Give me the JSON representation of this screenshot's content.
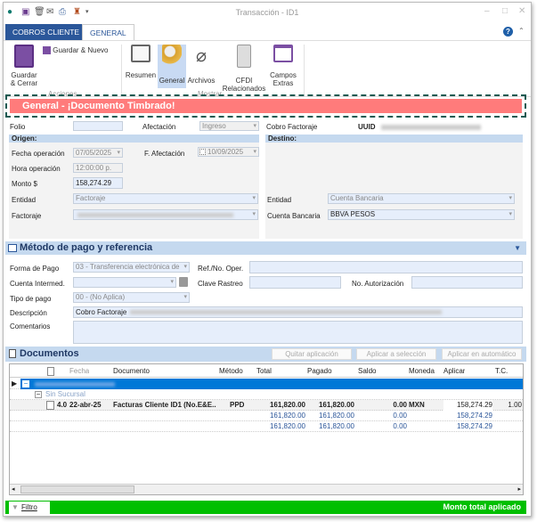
{
  "window": {
    "title": "Transacción - ID1"
  },
  "quick_access": [
    "app-icon",
    "save-icon",
    "delete-icon",
    "email-icon",
    "print-icon",
    "user-icon",
    "dropdown-icon"
  ],
  "tabs": [
    {
      "label": "COBROS CLIENTE"
    },
    {
      "label": "GENERAL"
    }
  ],
  "ribbon": {
    "actions": {
      "group": "Acciones",
      "save_close": "Guardar & Cerrar",
      "save_new": "Guardar & Nuevo"
    },
    "show": {
      "group": "Mostrar",
      "resumen": "Resumen",
      "general": "General",
      "archivos": "Archivos",
      "cfdi": "CFDI Relacionados",
      "campos": "Campos Extras"
    }
  },
  "banner": {
    "text": "General - ¡Documento Timbrado!"
  },
  "form": {
    "folio_label": "Folio",
    "folio": "",
    "afectacion_label": "Afectación",
    "afectacion": "Ingreso",
    "cobro_factoraje_label": "Cobro Factoraje",
    "uuid_label": "UUID",
    "origen": "Origen:",
    "destino": "Destino:",
    "fecha_op_label": "Fecha operación",
    "fecha_op": "07/05/2025",
    "f_afect_label": "F. Afectación",
    "f_afect": "10/09/2025",
    "hora_label": "Hora operación",
    "hora": "12:00:00 p.",
    "monto_label": "Monto  $",
    "monto": "158,274.29",
    "entidad_label": "Entidad",
    "entidad": "Factoraje",
    "factoraje_label": "Factoraje",
    "dest_entidad_label": "Entidad",
    "dest_entidad": "Cuenta Bancaria",
    "cuenta_label": "Cuenta Bancaria",
    "cuenta": "BBVA PESOS"
  },
  "metodo": {
    "title": "Método de pago y referencia",
    "forma_label": "Forma de Pago",
    "forma": "03 - Transferencia electrónica de",
    "ref_label": "Ref./No. Oper.",
    "cuenta_label": "Cuenta Intermed.",
    "clave_label": "Clave Rastreo",
    "aut_label": "No. Autorización",
    "tipo_label": "Tipo de pago",
    "tipo": "00 - (No Aplica)",
    "desc_label": "Descripción",
    "desc": "Cobro Factoraje",
    "coment_label": "Comentarios"
  },
  "documentos": {
    "title": "Documentos",
    "btn_quitar": "Quitar aplicación",
    "btn_sel": "Aplicar a selección",
    "btn_auto": "Aplicar en automático",
    "columns": [
      "Fecha",
      "Documento",
      "Método",
      "Total",
      "Pagado",
      "Saldo",
      "Moneda",
      "Aplicar",
      "T.C."
    ],
    "group2": "Sin Sucursal",
    "row": {
      "ver": "4.0",
      "fecha": "22-abr-25",
      "documento": "Facturas Cliente ID1 (No.E&E...",
      "metodo": "PPD",
      "total": "161,820.00",
      "pagado": "161,820.00",
      "saldo": "0.00",
      "moneda": "MXN",
      "aplicar": "158,274.29",
      "tc": "1.00"
    },
    "subtotal": {
      "total": "161,820.00",
      "pagado": "161,820.00",
      "saldo": "0.00",
      "aplicar": "158,274.29"
    },
    "grandtotal": {
      "total": "161,820.00",
      "pagado": "161,820.00",
      "saldo": "0.00",
      "aplicar": "158,274.29"
    }
  },
  "footer": {
    "filtro": "Filtro",
    "monto_total": "Monto total aplicado"
  },
  "colors": {
    "banner": "#ff7b7b",
    "tab_active": "#2b579a",
    "status": "#00bf00",
    "selected_row": "#0078d7"
  }
}
